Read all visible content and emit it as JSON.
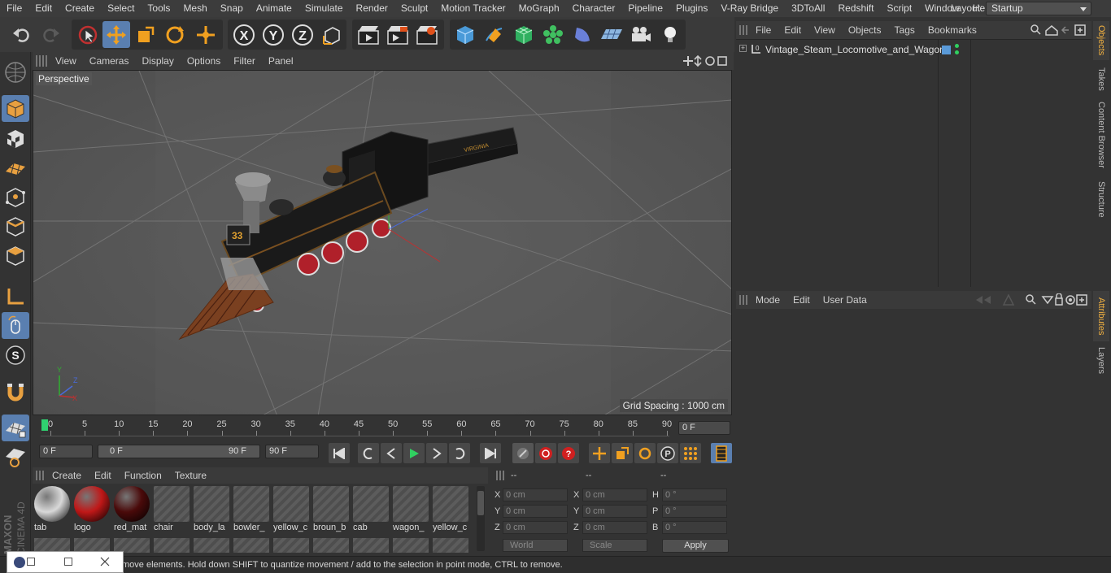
{
  "menubar": {
    "items": [
      "File",
      "Edit",
      "Create",
      "Select",
      "Tools",
      "Mesh",
      "Snap",
      "Animate",
      "Simulate",
      "Render",
      "Sculpt",
      "Motion Tracker",
      "MoGraph",
      "Character",
      "Pipeline",
      "Plugins",
      "V-Ray Bridge",
      "3DToAll",
      "Redshift",
      "Script",
      "Window",
      "Help"
    ],
    "layout_label": "Layout:",
    "layout_value": "Startup"
  },
  "toolbar": {
    "icons": [
      "undo-icon",
      "redo-icon",
      "live-selection-icon",
      "move-icon",
      "scale-icon",
      "rotate-icon",
      "multi-transform-icon",
      "x-axis-icon",
      "y-axis-icon",
      "z-axis-icon",
      "world-coordinates-icon",
      "render-view-icon",
      "render-picture-viewer-icon",
      "edit-render-settings-icon",
      "cube-icon",
      "pen-icon",
      "subdivision-icon",
      "cloner-icon",
      "deformer-icon",
      "floor-icon",
      "camera-icon",
      "light-icon"
    ]
  },
  "viewport": {
    "menu": [
      "View",
      "Cameras",
      "Display",
      "Options",
      "Filter",
      "Panel"
    ],
    "label": "Perspective",
    "grid_spacing": "Grid Spacing : 1000 cm",
    "colors": {
      "floor": "#5a5a5a",
      "grid_line": "#6e6e6e",
      "loco_body": "#1c1c1c",
      "wheel_red": "#b0202a",
      "wood": "#7a4020"
    }
  },
  "timeline": {
    "ticks": [
      "0",
      "5",
      "10",
      "15",
      "20",
      "25",
      "30",
      "35",
      "40",
      "45",
      "50",
      "55",
      "60",
      "65",
      "70",
      "75",
      "80",
      "85",
      "90"
    ],
    "current_frame": "0 F",
    "start_field": "0 F",
    "range_start": "0 F",
    "range_end": "90 F",
    "end_field": "90 F"
  },
  "materials": {
    "menu": [
      "Create",
      "Edit",
      "Function",
      "Texture"
    ],
    "items": [
      {
        "name": "tab",
        "swatch": "#d8d8d8"
      },
      {
        "name": "logo",
        "swatch": "#c01818"
      },
      {
        "name": "red_mat",
        "swatch": "#4a0a0a"
      },
      {
        "name": "chair",
        "swatch": "hatch"
      },
      {
        "name": "body_la",
        "swatch": "hatch"
      },
      {
        "name": "bowler_",
        "swatch": "hatch"
      },
      {
        "name": "yellow_c",
        "swatch": "hatch"
      },
      {
        "name": "broun_b",
        "swatch": "hatch"
      },
      {
        "name": "cab",
        "swatch": "hatch"
      },
      {
        "name": "wagon_",
        "swatch": "hatch"
      },
      {
        "name": "yellow_c",
        "swatch": "hatch"
      }
    ]
  },
  "coordinates": {
    "headers": [
      "--",
      "--",
      "--"
    ],
    "rows": [
      {
        "a": "X",
        "av": "0 cm",
        "b": "X",
        "bv": "0 cm",
        "c": "H",
        "cv": "0 °"
      },
      {
        "a": "Y",
        "av": "0 cm",
        "b": "Y",
        "bv": "0 cm",
        "c": "P",
        "cv": "0 °"
      },
      {
        "a": "Z",
        "av": "0 cm",
        "b": "Z",
        "bv": "0 cm",
        "c": "B",
        "cv": "0 °"
      }
    ],
    "mode_select": "World",
    "type_select": "Scale",
    "apply": "Apply"
  },
  "object_manager": {
    "menu": [
      "File",
      "Edit",
      "View",
      "Objects",
      "Tags",
      "Bookmarks"
    ],
    "objects": [
      {
        "name": "Vintage_Steam_Locomotive_and_Wagon"
      }
    ]
  },
  "attribute_manager": {
    "menu": [
      "Mode",
      "Edit",
      "User Data"
    ]
  },
  "right_tabs": {
    "top": [
      "Objects",
      "Takes",
      "Content Browser",
      "Structure"
    ],
    "bottom": [
      "Attributes",
      "Layers"
    ]
  },
  "status": {
    "text": "move elements. Hold down SHIFT to quantize movement / add to the selection in point mode, CTRL to remove."
  },
  "brand": {
    "line1": "MAXON",
    "line2": "CINEMA 4D"
  }
}
